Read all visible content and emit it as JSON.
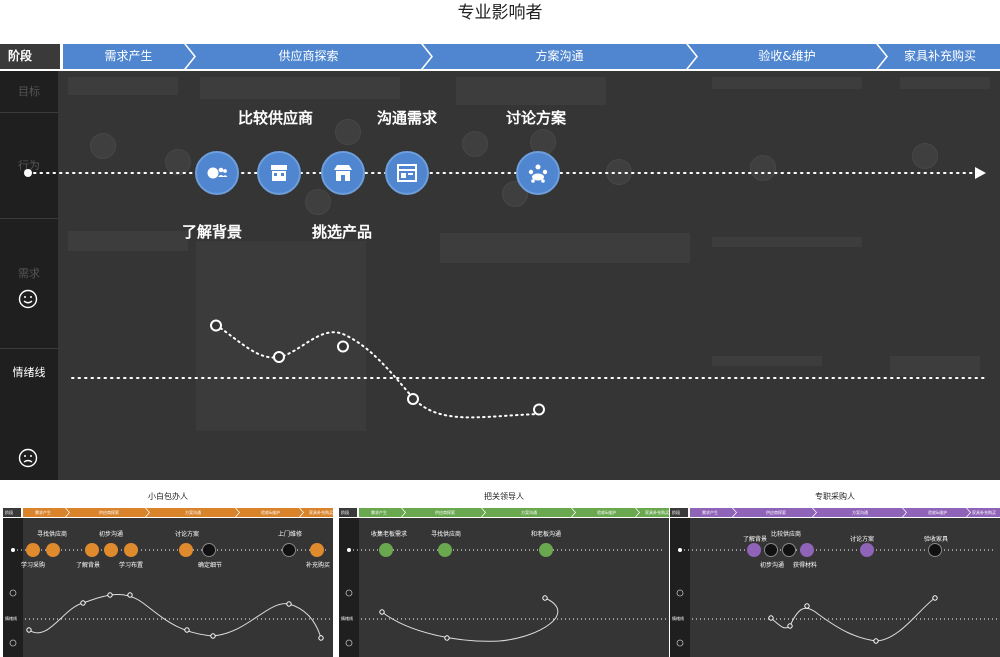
{
  "page_title": "专业影响者",
  "main": {
    "stage_head": "阶段",
    "stages": [
      {
        "label": "需求产生"
      },
      {
        "label": "供应商探索"
      },
      {
        "label": "方案沟通"
      },
      {
        "label": "验收&维护"
      },
      {
        "label": "家具补充购买"
      }
    ],
    "lanes": {
      "goal": "目标",
      "behavior": "行为",
      "needs": "需求",
      "emotion": "情绪线"
    },
    "touchpoints": [
      {
        "label": "了解背景",
        "icon": "people-globe-icon"
      },
      {
        "label": "比较供应商",
        "icon": "building-icon"
      },
      {
        "label": "挑选产品",
        "icon": "store-icon"
      },
      {
        "label": "沟通需求",
        "icon": "layout-icon"
      },
      {
        "label": "讨论方案",
        "icon": "meeting-icon"
      }
    ],
    "emotion_points": [
      5,
      2,
      3,
      -2,
      -3
    ]
  },
  "thumbnails": [
    {
      "title": "小白包办人",
      "stages": [
        "需求产生",
        "供应商探索",
        "方案沟通",
        "验收&维护",
        "家具补充购买"
      ],
      "stage_color": "#d9832b",
      "node_color": "#e08a2e",
      "lane_emotion": "情绪线",
      "labels": [
        "寻找供应商",
        "初步沟通",
        "讨论方案",
        "上门维修",
        "学习采购",
        "了解背景",
        "学习布置",
        "确定细节",
        "补充购买"
      ]
    },
    {
      "title": "把关领导人",
      "stages": [
        "需求产生",
        "供应商探索",
        "方案沟通",
        "验收&维护",
        "家具补充购买"
      ],
      "stage_color": "#6aa84f",
      "node_color": "#6aa84f",
      "lane_emotion": "情绪线",
      "labels": [
        "收集老板需求",
        "寻找供应商",
        "和老板沟通"
      ]
    },
    {
      "title": "专职采购人",
      "stages": [
        "需求产生",
        "供应商探索",
        "方案沟通",
        "验收&维护",
        "家具补充购买"
      ],
      "stage_color": "#8e63b8",
      "node_color": "#8e63b8",
      "lane_emotion": "情绪线",
      "labels": [
        "了解背景",
        "比较供应商",
        "讨论方案",
        "验收家具",
        "初步沟通",
        "获得材料"
      ]
    }
  ],
  "colors": {
    "stage_blue": "#4f86cf",
    "board": "#353535",
    "lane": "#1f1f1f"
  }
}
